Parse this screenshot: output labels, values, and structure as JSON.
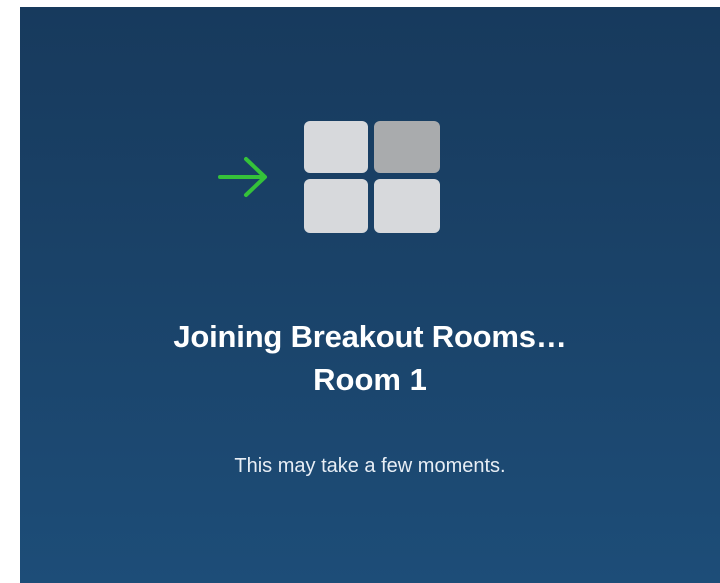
{
  "screen": {
    "title": "Joining Breakout Rooms…",
    "room_name": "Room 1",
    "subtitle": "This may take a few moments."
  },
  "icons": {
    "arrow": "arrow-right-icon",
    "rooms": "breakout-rooms-grid-icon"
  },
  "colors": {
    "background_top": "#173a5d",
    "background_bottom": "#1d4d78",
    "arrow": "#35c23a",
    "tile_light": "#d7d9dc",
    "tile_dark": "#a9abad"
  }
}
